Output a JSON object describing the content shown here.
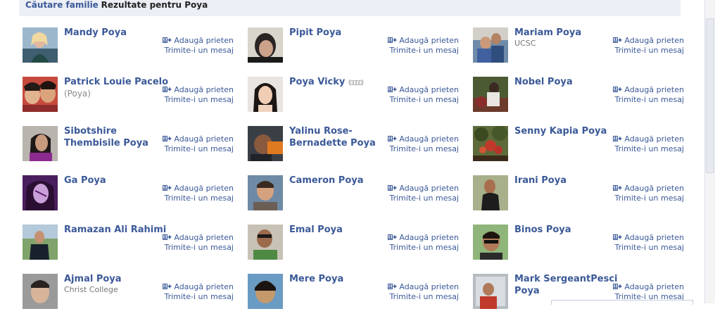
{
  "header": {
    "link": "Căutare familie",
    "title": "Rezultate pentru Poya"
  },
  "actions": {
    "add_friend": "Adaugă prieten",
    "message": "Trimite-i un mesaj"
  },
  "icons": {
    "add_friend_icon": "add-friend-icon"
  },
  "results": [
    {
      "name": "Mandy Poya",
      "sub": ""
    },
    {
      "name": "Pipit Poya",
      "sub": ""
    },
    {
      "name": "Mariam Poya",
      "sub": "UCSC"
    },
    {
      "name": "Patrick Louie Pacelo",
      "sub": "(Poya)"
    },
    {
      "name": "Poya Vicky",
      "sub": ""
    },
    {
      "name": "Nobel Poya",
      "sub": ""
    },
    {
      "name": "Sibotshire Thembisile Poya",
      "sub": ""
    },
    {
      "name": "Yalinu Rose-Bernadette Poya",
      "sub": ""
    },
    {
      "name": "Senny Kapia Poya",
      "sub": ""
    },
    {
      "name": "Ga Poya",
      "sub": ""
    },
    {
      "name": "Cameron Poya",
      "sub": ""
    },
    {
      "name": "Irani Poya",
      "sub": ""
    },
    {
      "name": "Ramazan Ali Rahimi",
      "sub": ""
    },
    {
      "name": "Emal Poya",
      "sub": ""
    },
    {
      "name": "Binos Poya",
      "sub": ""
    },
    {
      "name": "Ajmal Poya",
      "sub": "Christ College"
    },
    {
      "name": "Mere Poya",
      "sub": ""
    },
    {
      "name": "Mark SergeantPesci Poya",
      "sub": ""
    }
  ]
}
